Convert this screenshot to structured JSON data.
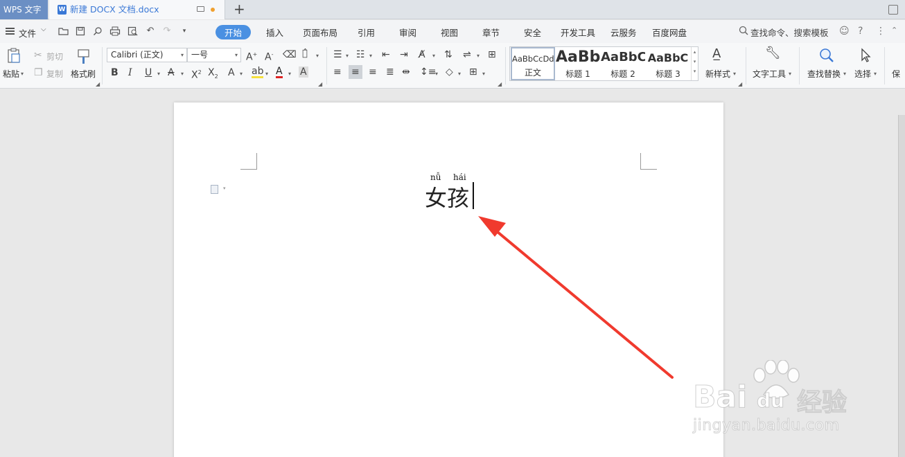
{
  "tabs": {
    "app": "WPS 文字",
    "document": "新建 DOCX 文档.docx",
    "new_tab": "+"
  },
  "menu": {
    "file": "文件",
    "tabs": [
      "开始",
      "插入",
      "页面布局",
      "引用",
      "审阅",
      "视图",
      "章节",
      "安全",
      "开发工具",
      "云服务",
      "百度网盘"
    ],
    "active_tab": "开始",
    "search": "查找命令、搜索模板",
    "accent_color": "#4a90e2"
  },
  "ribbon": {
    "paste": "粘贴",
    "cut": "剪切",
    "copy": "复制",
    "format_painter": "格式刷",
    "font_name": "Calibri (正文)",
    "font_size": "一号",
    "styles": [
      {
        "sample": "AaBbCcDd",
        "name": "正文"
      },
      {
        "sample": "AaBb",
        "name": "标题 1"
      },
      {
        "sample": "AaBbC",
        "name": "标题 2"
      },
      {
        "sample": "AaBbC",
        "name": "标题 3"
      }
    ],
    "new_style": "新样式",
    "text_tools": "文字工具",
    "find_replace": "查找替换",
    "select": "选择",
    "save_partial": "保"
  },
  "document": {
    "pinyin": [
      "nǚ",
      "hái"
    ],
    "text": "女孩"
  },
  "watermark": {
    "brand": "Bai",
    "brand2": "du",
    "suffix": "经验",
    "url": "jingyan.baidu.com"
  },
  "annotation": {
    "arrow_color": "#f03a2e"
  }
}
